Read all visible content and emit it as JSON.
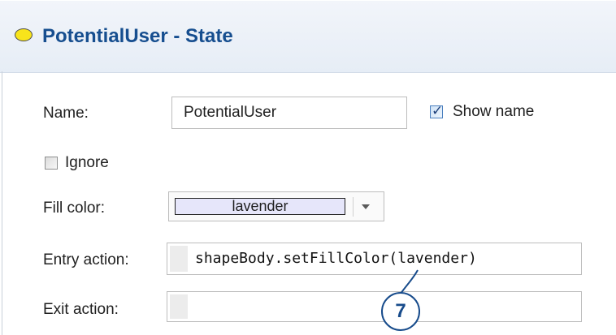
{
  "header": {
    "title": "PotentialUser - State",
    "icon": "state-ellipse-icon",
    "icon_color": "#f8e41b"
  },
  "form": {
    "name_label": "Name:",
    "name_value": "PotentialUser",
    "show_name_label": "Show name",
    "show_name_checked": true,
    "ignore_label": "Ignore",
    "ignore_checked": false,
    "fill_color_label": "Fill color:",
    "fill_color_value": "lavender",
    "fill_color_swatch": "#e6e6fa",
    "entry_action_label": "Entry action:",
    "entry_action_value": "shapeBody.setFillColor(lavender)",
    "exit_action_label": "Exit action:",
    "exit_action_value": ""
  },
  "callout": {
    "number": "7",
    "color": "#174b8b"
  }
}
